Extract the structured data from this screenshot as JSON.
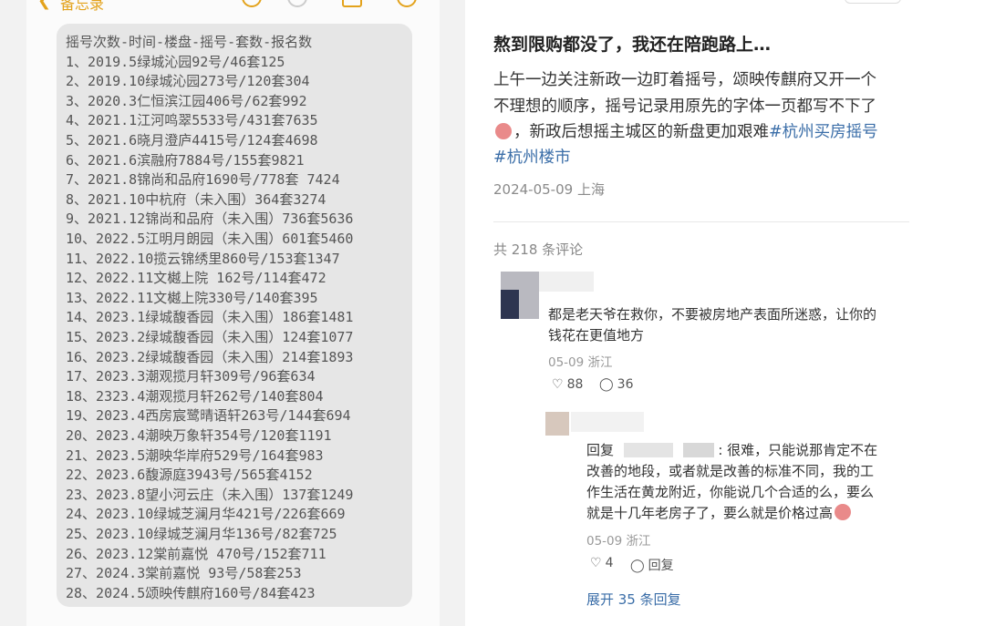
{
  "notes_app": {
    "back_label": "备忘录",
    "lines": [
      "摇号次数-时间-楼盘-摇号-套数-报名数",
      "1、2019.5绿城沁园92号/46套125",
      "2、2019.10绿城沁园273号/120套304",
      "3、2020.3仁恒滨江园406号/62套992",
      "4、2021.1江河鸣翠5533号/431套7635",
      "5、2021.6晓月澄庐4415号/124套4698",
      "6、2021.6滨融府7884号/155套9821",
      "7、2021.8锦尚和品府1690号/778套 7424",
      "8、2021.10中杭府（未入围）364套3274",
      "9、2021.12锦尚和品府（未入围）736套5636",
      "10、2022.5江明月朗园（未入围）601套5460",
      "11、2022.10揽云锦绣里860号/153套1347",
      "12、2022.11文樾上院 162号/114套472",
      "13、2022.11文樾上院330号/140套395",
      "14、2023.1绿城馥香园（未入围）186套1481",
      "15、2023.2绿城馥香园（未入围）124套1077",
      "16、2023.2绿城馥香园（未入围）214套1893",
      "17、2023.3潮观揽月轩309号/96套634",
      "18、2323.4潮观揽月轩262号/140套804",
      "19、2023.4西房宸鹭晴语轩263号/144套694",
      "20、2023.4潮映万象轩354号/120套1191",
      "21、2023.5潮映华岸府529号/164套983",
      "22、2023.6馥源庭3943号/565套4152",
      "23、2023.8望小河云庄（未入围）137套1249",
      "24、2023.10绿城芝澜月华421号/226套669",
      "25、2023.10绿城芝澜月华136号/82套725",
      "26、2023.12棠前嘉悦 470号/152套711",
      "27、2024.3棠前嘉悦 93号/58套253",
      "28、2024.5颂映传麒府160号/84套423"
    ]
  },
  "post": {
    "title": "熬到限购都没了，我还在陪跑路上…",
    "body_line1": "上午一边关注新政一边盯着摇号，颂映传麒府又开一个",
    "body_line2": "不理想的顺序，摇号记录用原先的字体一页都写不下了",
    "body_line3_text": "，新政后想摇主城区的新盘更加艰难",
    "tag1": "#杭州买房摇号",
    "tag2": "#杭州楼市",
    "meta": "2024-05-09 上海"
  },
  "comments": {
    "count_label": "共 218 条评论",
    "c1": {
      "line1": "都是老天爷在救你，不要被房地产表面所迷惑，让你的",
      "line2": "钱花在更值地方",
      "meta": "05-09 浙江",
      "likes": "88",
      "replies": "36"
    },
    "r1": {
      "prefix": "回复",
      "line1_tail": ": 很难，只能说那肯定不在",
      "line2": "改善的地段，或者就是改善的标准不同，我的工",
      "line3": "作生活在黄龙附近，你能说几个合适的么，要么",
      "line4": "就是十几年老房子了，要么就是价格过高",
      "meta": "05-09 浙江",
      "likes": "4",
      "reply_label": "回复"
    },
    "expand_label": "展开 35 条回复"
  },
  "icons": {
    "like": "heart-outline-icon",
    "comment": "speech-bubble-icon"
  },
  "colors": {
    "accent_notes": "#e3a21b",
    "link_blue": "#3b6ea8"
  }
}
